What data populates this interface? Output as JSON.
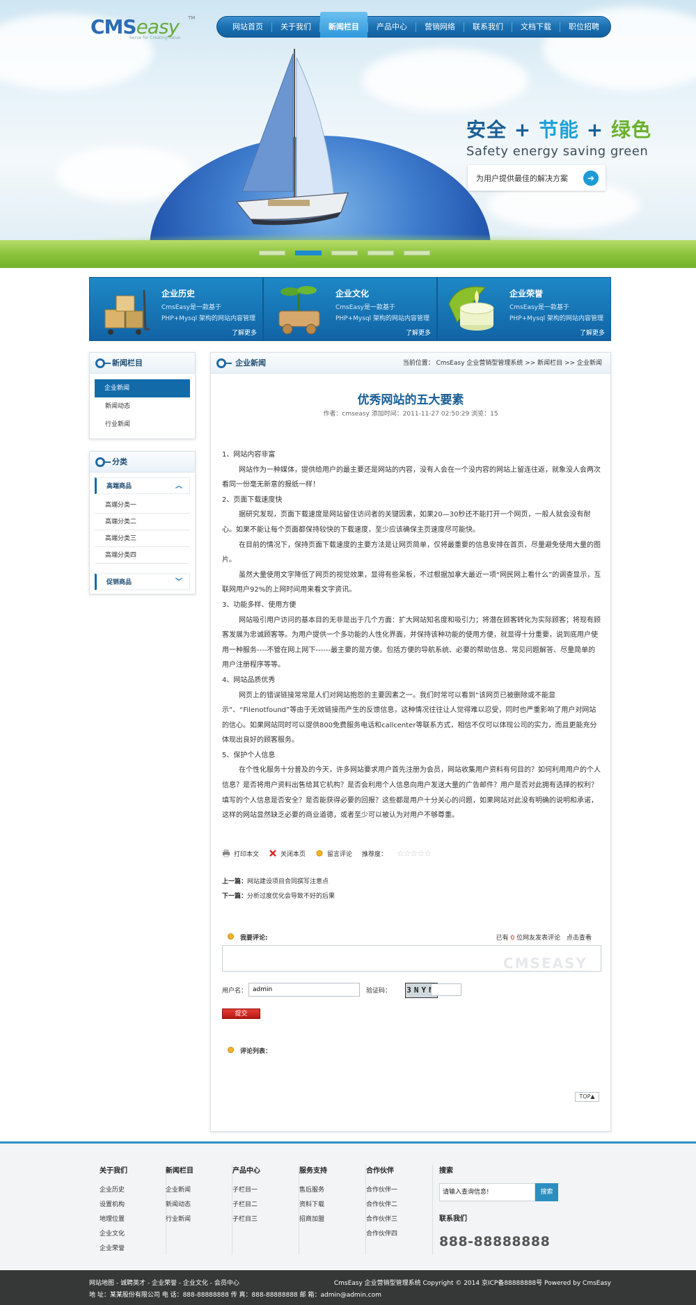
{
  "brand": {
    "logo_main": "CMS",
    "logo_accent": "easy",
    "logo_tagline": "Serve for Creating value",
    "logo_tm": "TM"
  },
  "nav": {
    "items": [
      "网站首页",
      "关于我们",
      "新闻栏目",
      "产品中心",
      "营销网络",
      "联系我们",
      "文档下载",
      "职位招聘"
    ],
    "active_index": 2
  },
  "banner": {
    "slogan_part1": "安全",
    "plus": "+",
    "slogan_part2": "节能",
    "slogan_part3": "绿色",
    "slogan_en": "Safety energy saving  green",
    "cta_text": "为用户提供最佳的解决方案",
    "slide_count": 5,
    "active_slide": 1
  },
  "features": [
    {
      "title": "企业历史",
      "desc1": "CmsEasy是一款基于",
      "desc2": "PHP+Mysql 架构的网站内容管理",
      "more": "了解更多"
    },
    {
      "title": "企业文化",
      "desc1": "CmsEasy是一款基于",
      "desc2": "PHP+Mysql 架构的网站内容管理",
      "more": "了解更多"
    },
    {
      "title": "企业荣誉",
      "desc1": "CmsEasy是一款基于",
      "desc2": "PHP+Mysql 架构的网站内容管理",
      "more": "了解更多"
    }
  ],
  "sidebar": {
    "news_title": "新闻栏目",
    "news_links": [
      "企业新闻",
      "新闻动态",
      "行业新闻"
    ],
    "news_active": 0,
    "cat_title": "分类",
    "cat1": "高端商品",
    "cat1_subs": [
      "高端分类一",
      "高端分类二",
      "高端分类三",
      "高端分类四"
    ],
    "cat2": "促销商品"
  },
  "main": {
    "section_title": "企业新闻",
    "crumb": "当前位置： CmsEasy 企业营销型管理系统  >> 新闻栏目  >> 企业新闻",
    "article_title": "优秀网站的五大要素",
    "meta": "作者：cmseasy    添加时间：2011-11-27 02:50:29    浏览：15",
    "body": [
      {
        "t": "h",
        "text": "1、网站内容非富"
      },
      {
        "t": "p",
        "text": "网站作为一种媒体，提供给用户的最主要还是网站的内容，没有人会在一个没内容的网站上留连往返，就象没人会两次看同一份毫无新意的报纸一样！"
      },
      {
        "t": "h",
        "text": "2、页面下载速度快"
      },
      {
        "t": "p",
        "text": "据研究发现，页面下载速度是网站留住访问者的关键因素，如果20—30秒还不能打开一个网页，一般人就会没有耐心。如果不能让每个页面都保持较快的下载速度，至少应该确保主页速度尽可能快。"
      },
      {
        "t": "p",
        "text": "在目前的情况下，保持页面下载速度的主要方法是让网页简单，仅将最重要的信息安排在首页，尽量避免使用大量的图片。"
      },
      {
        "t": "p",
        "text": "虽然大量使用文字降低了网页的视觉效果，显得有些呆板，不过根据加拿大最近一项“网民网上看什么”的调查显示，互联网用户92%的上网时间用来看文字资讯。"
      },
      {
        "t": "h",
        "text": "3、功能多样、使用方便"
      },
      {
        "t": "p",
        "text": "网站吸引用户访问的基本目的无非是出于几个方面：扩大网站知名度和吸引力；将潜在顾客转化为实际顾客；将现有顾客发展为忠诚顾客等。为用户提供一个多功能的人性化界面，并保持该种功能的使用方便，就显得十分重要，说到底用户使用一种服务----不管在网上网下------最主要的是方便。包括方便的导航系统、必要的帮助信息、常见问题解答、尽量简单的用户注册程序等等。"
      },
      {
        "t": "h",
        "text": "4、网站品质优秀"
      },
      {
        "t": "p",
        "text": "网页上的错误链接常常是人们对网站抱怨的主要因素之一。我们时常可以看到“该网页已被删除或不能显示”、“Filenotfound”等由于无效链接而产生的反馈信息，这种情况往往让人觉得难以忍受，同时也严重影响了用户对网站的信心。如果网站同时可以提供800免费服务电话和callcenter等联系方式，相信不仅可以体现公司的实力，而且更能充分体现出良好的顾客服务。"
      },
      {
        "t": "h",
        "text": "5、保护个人信息"
      },
      {
        "t": "p",
        "text": "在个性化服务十分普及的今天，许多网站要求用户首先注册为会员，网站收集用户资料有何目的？如何利用用户的个人信息？是否将用户资料出售给其它机构？是否会利用个人信息向用户发送大量的广告邮件？用户是否对此拥有选择的权利？填写的个人信息是否安全？是否能获得必要的回报？这些都是用户十分关心的问题，如果网站对此没有明确的说明和承诺，这样的网站显然缺乏必要的商业道德，或者至少可以被认为对用户不够尊重。"
      }
    ],
    "tools": {
      "print": "打印本文",
      "close": "关闭本页",
      "comment": "留言评论",
      "rating_label": "推荐度：",
      "rating": 0,
      "rating_max": 5
    },
    "prev_label": "上一篇：",
    "prev": "网站建设项目合同撰写注意点",
    "next_label": "下一篇：",
    "next": "分析过度优化会导致不好的后果",
    "comment": {
      "label": "我要评论:",
      "count_pre": "已有",
      "count": "0",
      "count_post": "位网友发表评论",
      "view": "点击查看",
      "watermark": "CMSEASY",
      "user_label": "用户名：",
      "user_value": "admin",
      "captcha_label": "验证码：",
      "captcha_text": "3NYN",
      "submit": "提交"
    },
    "list_label": "评论列表：",
    "top": "TOP▲"
  },
  "footer": {
    "cols": [
      {
        "title": "关于我们",
        "items": [
          "企业历史",
          "设置机构",
          "地理位置",
          "企业文化",
          "企业荣誉"
        ]
      },
      {
        "title": "新闻栏目",
        "items": [
          "企业新闻",
          "新闻动态",
          "行业新闻"
        ]
      },
      {
        "title": "产品中心",
        "items": [
          "子栏目一",
          "子栏目二",
          "子栏目三"
        ]
      },
      {
        "title": "服务支持",
        "items": [
          "售后服务",
          "资料下载",
          "招商加盟"
        ]
      },
      {
        "title": "合作伙伴",
        "items": [
          "合作伙伴一",
          "合作伙伴二",
          "合作伙伴三",
          "合作伙伴四"
        ]
      }
    ],
    "search_title": "搜索",
    "search_placeholder": "请输入查询信息!",
    "search_button": "搜索",
    "contact_title": "联系我们",
    "phone": "888-88888888"
  },
  "bottom": {
    "links": "网站地图 - 诚聘英才 - 企业荣誉 - 企业文化 - 会员中心",
    "address": "地 址：某某股份有限公司  电 话：888-88888888  传 真：888-88888888  邮 箱：admin@admin.com",
    "copyright": "CmsEasy 企业营销型管理系统  Copyright © 2014  京ICP备88888888号  Powered by CmsEasy"
  },
  "colors": {
    "primary": "#126aa9",
    "accent": "#1fa1d8",
    "green": "#6bb12b",
    "footer_line": "#2d8ec8"
  }
}
